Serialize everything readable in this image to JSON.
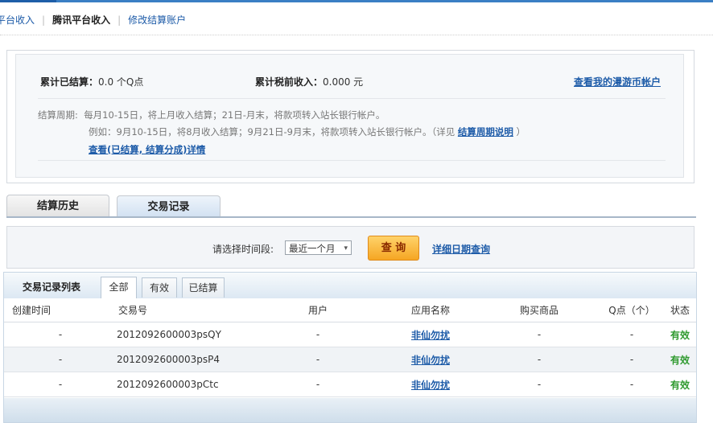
{
  "nav": {
    "items": [
      {
        "label": "平台收入",
        "current": false
      },
      {
        "label": "腾讯平台收入",
        "current": true
      },
      {
        "label": "修改结算账户",
        "current": false
      }
    ],
    "separator": "|"
  },
  "summary": {
    "settled_label": "累计已结算：",
    "settled_value": "0.0 个Q点",
    "pretax_label": "累计税前收入：",
    "pretax_value": "0.000 元",
    "account_link": "查看我的漫游币帐户",
    "cycle_label": "结算周期:",
    "cycle_text": "每月10-15日，将上月收入结算；21日-月末，将款项转入站长银行帐户。",
    "example_text": "例如：9月10-15日，将8月收入结算；9月21日-9月末，将款项转入站长银行帐户。（详见",
    "example_link": "结算周期说明",
    "example_end": "）",
    "detail_link": "查看(已结算, 结算分成)详情"
  },
  "tabs": [
    {
      "label": "结算历史"
    },
    {
      "label": "交易记录"
    }
  ],
  "filter": {
    "label": "请选择时间段:",
    "selected": "最近一个月",
    "query_button": "查 询",
    "advanced_link": "详细日期查询"
  },
  "list": {
    "title": "交易记录列表",
    "subtabs": [
      "全部",
      "有效",
      "已结算"
    ],
    "columns": [
      "创建时间",
      "交易号",
      "用户",
      "应用名称",
      "购买商品",
      "Q点（个）",
      "状态"
    ],
    "rows": [
      {
        "created": "-",
        "txn": "2012092600003psQY",
        "user": "-",
        "app": "非仙勿扰",
        "item": "-",
        "points": "-",
        "status": "有效"
      },
      {
        "created": "-",
        "txn": "2012092600003psP4",
        "user": "-",
        "app": "非仙勿扰",
        "item": "-",
        "points": "-",
        "status": "有效"
      },
      {
        "created": "-",
        "txn": "2012092600003pCtc",
        "user": "-",
        "app": "非仙勿扰",
        "item": "-",
        "points": "-",
        "status": "有效"
      }
    ]
  },
  "colors": {
    "link": "#1d5ba8",
    "status_ok": "#2f9a2f",
    "button": "#f5a623",
    "top_bar": "#3b7fc4"
  }
}
